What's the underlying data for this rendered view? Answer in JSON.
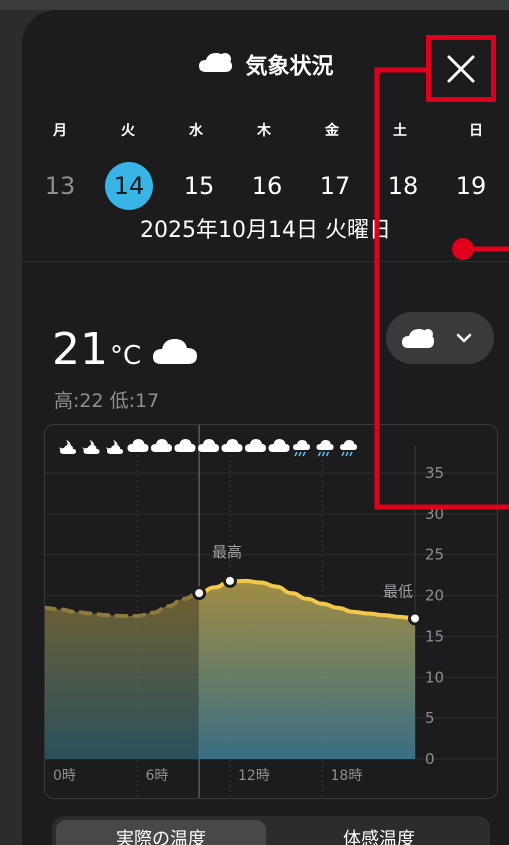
{
  "header": {
    "title": "気象状況",
    "close_label": "閉じる"
  },
  "week": {
    "weekdays": [
      "月",
      "火",
      "水",
      "木",
      "金",
      "土",
      "日"
    ],
    "dates": [
      "13",
      "14",
      "15",
      "16",
      "17",
      "18",
      "19"
    ],
    "selected_index": 1,
    "full_date": "2025年10月14日 火曜日"
  },
  "current": {
    "temp": "21",
    "unit": "°C",
    "hilo": "高:22 低:17",
    "condition_icon": "cloud-icon"
  },
  "dropdown": {
    "icon": "cloud-icon",
    "chevron": "chevron-down-icon"
  },
  "chart_data": {
    "type": "area",
    "title": "",
    "x_ticks": [
      "0時",
      "6時",
      "12時",
      "18時"
    ],
    "y_ticks": [
      "0",
      "5",
      "10",
      "15",
      "20",
      "25",
      "30",
      "35"
    ],
    "ylim": [
      0,
      35
    ],
    "xlim": [
      0,
      24
    ],
    "current_hour": 10,
    "annotations": [
      {
        "label": "最高",
        "x": 12,
        "y": 21.8
      },
      {
        "label": "最低",
        "x": 24,
        "y": 17.2
      }
    ],
    "series": [
      {
        "x": [
          0,
          1,
          2,
          3,
          4,
          5,
          6,
          7,
          8,
          9,
          10,
          11,
          12,
          13,
          14,
          15,
          16,
          17,
          18,
          19,
          20,
          21,
          22,
          23,
          24
        ],
        "values": [
          18.5,
          18.3,
          18.0,
          17.8,
          17.6,
          17.5,
          17.5,
          17.9,
          18.7,
          19.6,
          20.3,
          21.0,
          21.7,
          21.8,
          21.6,
          21.1,
          20.3,
          19.6,
          19.0,
          18.5,
          18.0,
          17.8,
          17.6,
          17.4,
          17.2
        ]
      }
    ],
    "hourly_icons": [
      "moon-cloud-icon",
      "moon-cloud-icon",
      "moon-cloud-icon",
      "cloud-icon",
      "cloud-icon",
      "cloud-icon",
      "cloud-icon",
      "cloud-icon",
      "cloud-icon",
      "cloud-icon",
      "sun-rain-icon",
      "rain-icon",
      "rain-icon"
    ]
  },
  "segment": {
    "options": [
      "実際の温度",
      "体感温度"
    ],
    "selected_index": 0
  },
  "colors": {
    "accent": "#39b4e6",
    "annotation": "#e0001b",
    "line": "#f2c84b"
  }
}
